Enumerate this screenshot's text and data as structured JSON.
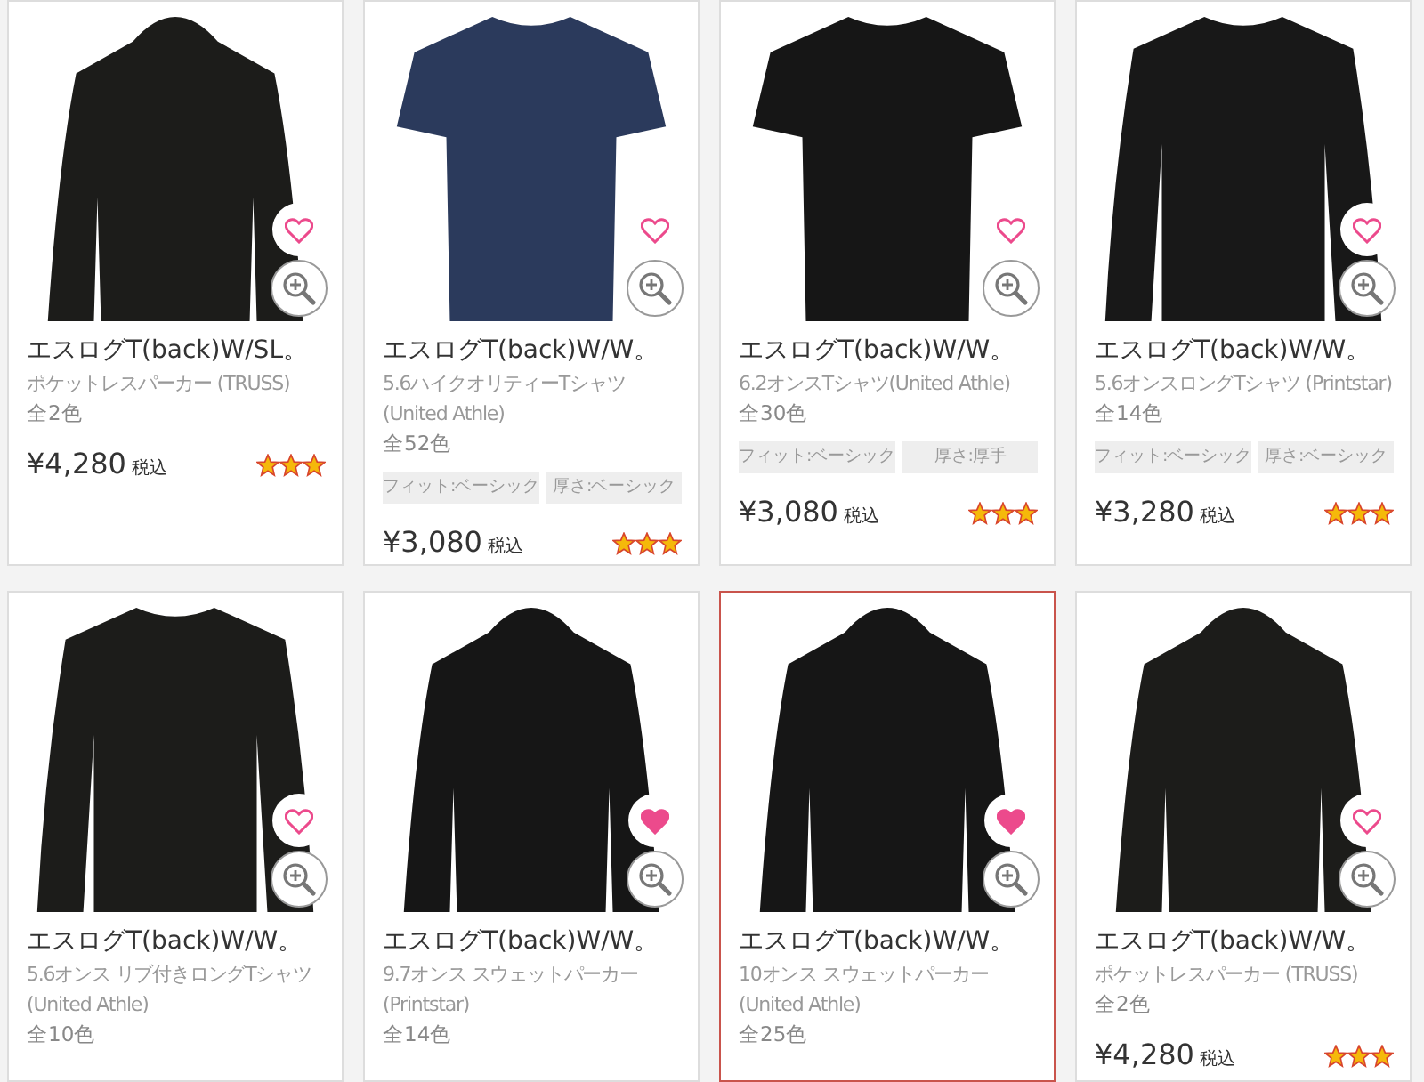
{
  "products": [
    {
      "name": "エスログT(back)W/SL。",
      "subtitle": "ポケットレスパーカー (TRUSS)",
      "colors": "全2色",
      "price": "¥4,280",
      "tax_label": "税込",
      "stars": 3,
      "favorite": false,
      "highlighted": false,
      "garment": {
        "kind": "hoodie",
        "color": "#1c1c1a"
      }
    },
    {
      "name": "エスログT(back)W/W。",
      "subtitle": "5.6ハイクオリティーTシャツ (United Athle)",
      "colors": "全52色",
      "tags": [
        "フィット:ベーシック",
        "厚さ:ベーシック"
      ],
      "price": "¥3,080",
      "tax_label": "税込",
      "stars": 3,
      "favorite": false,
      "highlighted": false,
      "garment": {
        "kind": "tshirt",
        "color": "#2b3a5c"
      }
    },
    {
      "name": "エスログT(back)W/W。",
      "subtitle": "6.2オンスTシャツ(United Athle)",
      "colors": "全30色",
      "tags": [
        "フィット:ベーシック",
        "厚さ:厚手"
      ],
      "price": "¥3,080",
      "tax_label": "税込",
      "stars": 3,
      "favorite": false,
      "highlighted": false,
      "garment": {
        "kind": "tshirt",
        "color": "#161616"
      }
    },
    {
      "name": "エスログT(back)W/W。",
      "subtitle": "5.6オンスロングTシャツ (Printstar)",
      "colors": "全14色",
      "tags": [
        "フィット:ベーシック",
        "厚さ:ベーシック"
      ],
      "price": "¥3,280",
      "tax_label": "税込",
      "stars": 3,
      "favorite": false,
      "highlighted": false,
      "garment": {
        "kind": "longsleeve",
        "color": "#181818"
      }
    },
    {
      "name": "エスログT(back)W/W。",
      "subtitle": "5.6オンス リブ付きロングTシャツ (United Athle)",
      "colors": "全10色",
      "favorite": false,
      "highlighted": false,
      "garment": {
        "kind": "longsleeve",
        "color": "#1c1c1a"
      }
    },
    {
      "name": "エスログT(back)W/W。",
      "subtitle": "9.7オンス スウェットパーカー (Printstar)",
      "colors": "全14色",
      "favorite": true,
      "highlighted": false,
      "garment": {
        "kind": "hoodie",
        "color": "#161616"
      }
    },
    {
      "name": "エスログT(back)W/W。",
      "subtitle": "10オンス スウェットパーカー (United Athle)",
      "colors": "全25色",
      "favorite": true,
      "highlighted": true,
      "garment": {
        "kind": "hoodie",
        "color": "#161616"
      }
    },
    {
      "name": "エスログT(back)W/W。",
      "subtitle": "ポケットレスパーカー (TRUSS)",
      "colors": "全2色",
      "price": "¥4,280",
      "tax_label": "税込",
      "stars": 3,
      "favorite": false,
      "highlighted": false,
      "garment": {
        "kind": "hoodie",
        "color": "#1c1c1a"
      }
    }
  ]
}
